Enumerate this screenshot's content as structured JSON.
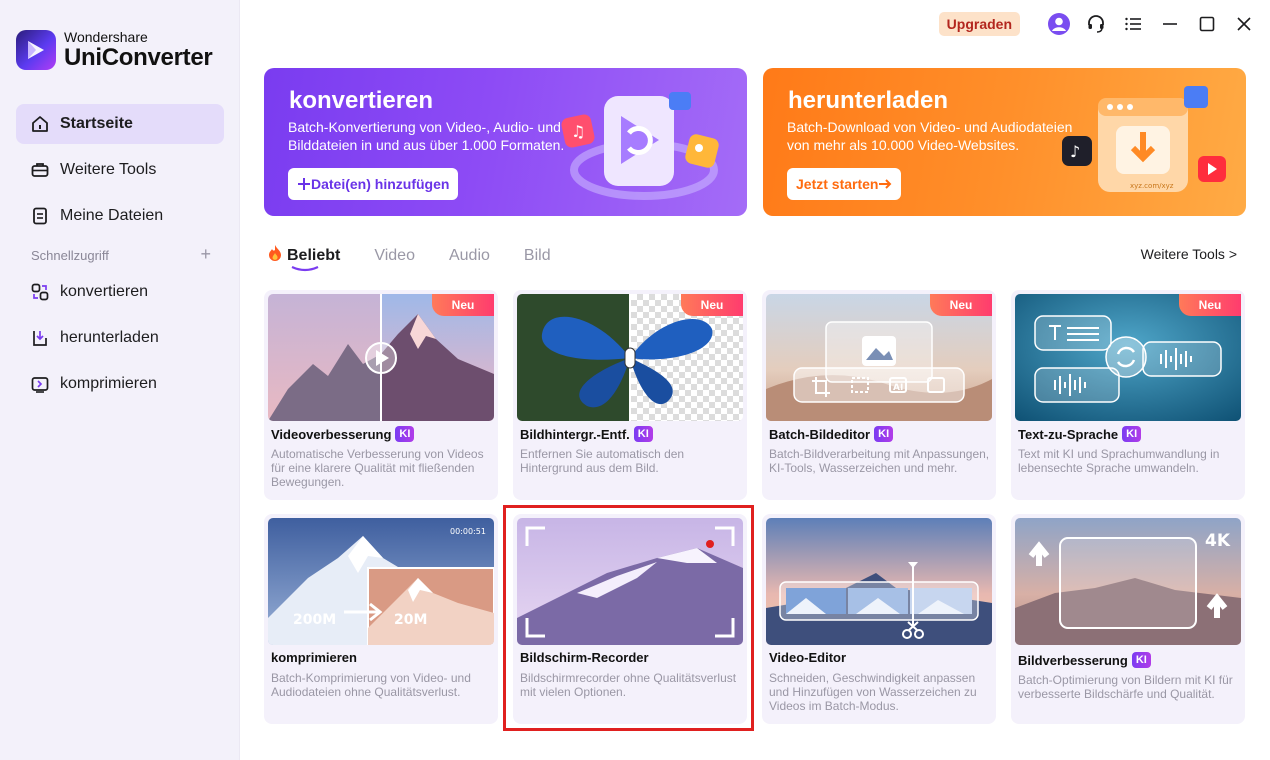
{
  "app": {
    "brand_small": "Wondershare",
    "brand_big": "UniConverter"
  },
  "titlebar": {
    "upgrade_label": "Upgraden"
  },
  "sidebar": {
    "items": [
      {
        "label": "Startseite",
        "icon": "home-icon",
        "active": true
      },
      {
        "label": "Weitere Tools",
        "icon": "toolbox-icon"
      },
      {
        "label": "Meine Dateien",
        "icon": "file-icon"
      }
    ],
    "quick_access_label": "Schnellzugriff",
    "quick_items": [
      {
        "label": "konvertieren",
        "icon": "convert-icon"
      },
      {
        "label": "herunterladen",
        "icon": "download-icon"
      },
      {
        "label": "komprimieren",
        "icon": "compress-icon"
      }
    ]
  },
  "banners": {
    "convert": {
      "title": "konvertieren",
      "text": "Batch-Konvertierung von Video-, Audio- und Bilddateien in und aus über 1.000 Formaten.",
      "button": "Datei(en) hinzufügen",
      "button_icon": "plus-icon"
    },
    "download": {
      "title": "herunterladen",
      "text": "Batch-Download von Video- und Audiodateien von mehr als 10.000 Video-Websites.",
      "button": "Jetzt starten",
      "button_icon": "arrow-right-icon",
      "art_url_text": "xyz.com/xyz"
    }
  },
  "tabs": {
    "items": [
      "Beliebt",
      "Video",
      "Audio",
      "Bild"
    ],
    "active": "Beliebt",
    "more": "Weitere Tools >"
  },
  "cards": [
    {
      "title": "Videoverbesserung",
      "ki": "KI",
      "badge": "Neu",
      "desc": "Automatische Verbesserung von Videos für eine klarere Qualität mit fließenden Bewegungen."
    },
    {
      "title": "Bildhintergr.-Entf.",
      "ki": "KI",
      "badge": "Neu",
      "desc": "Entfernen Sie automatisch den Hintergrund aus dem Bild."
    },
    {
      "title": "Batch-Bildeditor",
      "ki": "KI",
      "badge": "Neu",
      "desc": "Batch-Bildverarbeitung mit Anpassungen, KI-Tools, Wasserzeichen und mehr."
    },
    {
      "title": "Text-zu-Sprache",
      "ki": "KI",
      "badge": "Neu",
      "desc": "Text mit KI und Sprachumwandlung in lebensechte Sprache umwandeln."
    },
    {
      "title": "komprimieren",
      "desc": "Batch-Komprimierung von Video- und Audiodateien ohne Qualitätsverlust.",
      "thumb_timecode": "00:00:51",
      "thumb_from": "200M",
      "thumb_to": "20M"
    },
    {
      "title": "Bildschirm-Recorder",
      "desc": "Bildschirmrecorder ohne Qualitätsverlust mit vielen Optionen.",
      "selected": true
    },
    {
      "title": "Video-Editor",
      "desc": "Schneiden, Geschwindigkeit anpassen und Hinzufügen von Wasserzeichen zu Videos im Batch-Modus."
    },
    {
      "title": "Bildverbesserung",
      "ki": "KI",
      "desc": "Batch-Optimierung von Bildern mit KI für verbesserte Bildschärfe und Qualität.",
      "thumb_label": "4K"
    }
  ],
  "colors": {
    "accent": "#7a3cf0",
    "orange": "#ff8a25",
    "selected_border": "#e0201f",
    "upgrade_text": "#b3261e"
  }
}
